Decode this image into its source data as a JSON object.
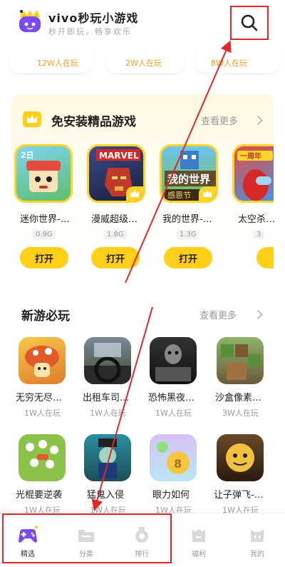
{
  "header": {
    "title": "vivo秒玩小游戏",
    "subtitle": "秒开即玩，畅享欢乐"
  },
  "top_row": {
    "counts": [
      "12W人在玩",
      "2W人在玩",
      "8W人在玩"
    ]
  },
  "section_install_free": {
    "title": "免安装精品游戏",
    "see_more": "查看更多",
    "open_label": "打开",
    "games": [
      {
        "name": "迷你世界-…",
        "size": "0.9G",
        "art_text": "2日"
      },
      {
        "name": "漫威超级…",
        "size": "1.8G",
        "art_text": "MARVEL"
      },
      {
        "name": "我的世界-…",
        "size": "1.3G",
        "art_text": "我的世界"
      },
      {
        "name": "太空杀…",
        "size": "3",
        "art_text": "一周年"
      }
    ]
  },
  "section_new_games": {
    "title": "新游必玩",
    "see_more": "查看更多",
    "row1": [
      {
        "name": "无穷无尽…",
        "count": "1W人在玩"
      },
      {
        "name": "出租车司…",
        "count": "1W人在玩"
      },
      {
        "name": "恐怖黑夜…",
        "count": "1W人在玩"
      },
      {
        "name": "沙盒像素…",
        "count": "3W人在玩"
      }
    ],
    "row2": [
      {
        "name": "光棍要逆袭",
        "count": "1W人在玩"
      },
      {
        "name": "猛鬼入侵",
        "count": "1W人在玩"
      },
      {
        "name": "眼力如何",
        "count": "1W人在玩"
      },
      {
        "name": "让子弹飞-…",
        "count": "1W人在玩"
      }
    ]
  },
  "bottom_nav": {
    "items": [
      {
        "label": "精选",
        "icon": "gamepad-icon",
        "active": true
      },
      {
        "label": "分类",
        "icon": "folder-icon",
        "active": false
      },
      {
        "label": "排行",
        "icon": "ranking-icon",
        "active": false
      },
      {
        "label": "福利",
        "icon": "gift-icon",
        "active": false
      },
      {
        "label": "我的",
        "icon": "profile-icon",
        "active": false
      }
    ]
  },
  "colors": {
    "accent_yellow": "#ffcf1a",
    "annotation_red": "#e02828",
    "active_purple": "#7a4cf0"
  }
}
